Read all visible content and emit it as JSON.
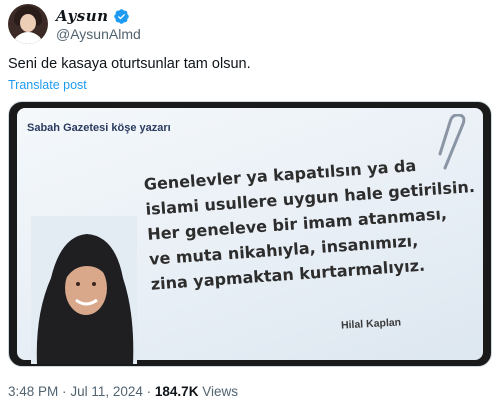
{
  "author": {
    "display_name": "Aysun",
    "handle": "@AysunAlmd",
    "verified_color": "#1d9bf0"
  },
  "tweet": {
    "text": "Seni de kasaya oturtsunlar tam olsun.",
    "translate_label": "Translate post"
  },
  "media": {
    "paper_title": "Sabah Gazetesi köşe yazarı",
    "quote_lines": [
      "Genelevler ya kapatılsın ya da",
      "islami usullere uygun hale getirilsin.",
      "Her geneleve bir imam atanması,",
      "ve muta nikahıyla, insanımızı,",
      "zina yapmaktan kurtarmalıyız."
    ],
    "author_name": "Hilal Kaplan"
  },
  "meta": {
    "time": "3:48 PM",
    "separator": "·",
    "date": "Jul 11, 2024",
    "views_count": "184.7K",
    "views_label": "Views"
  },
  "colors": {
    "text_primary": "#0f1419",
    "text_secondary": "#536471",
    "link": "#1d9bf0"
  }
}
